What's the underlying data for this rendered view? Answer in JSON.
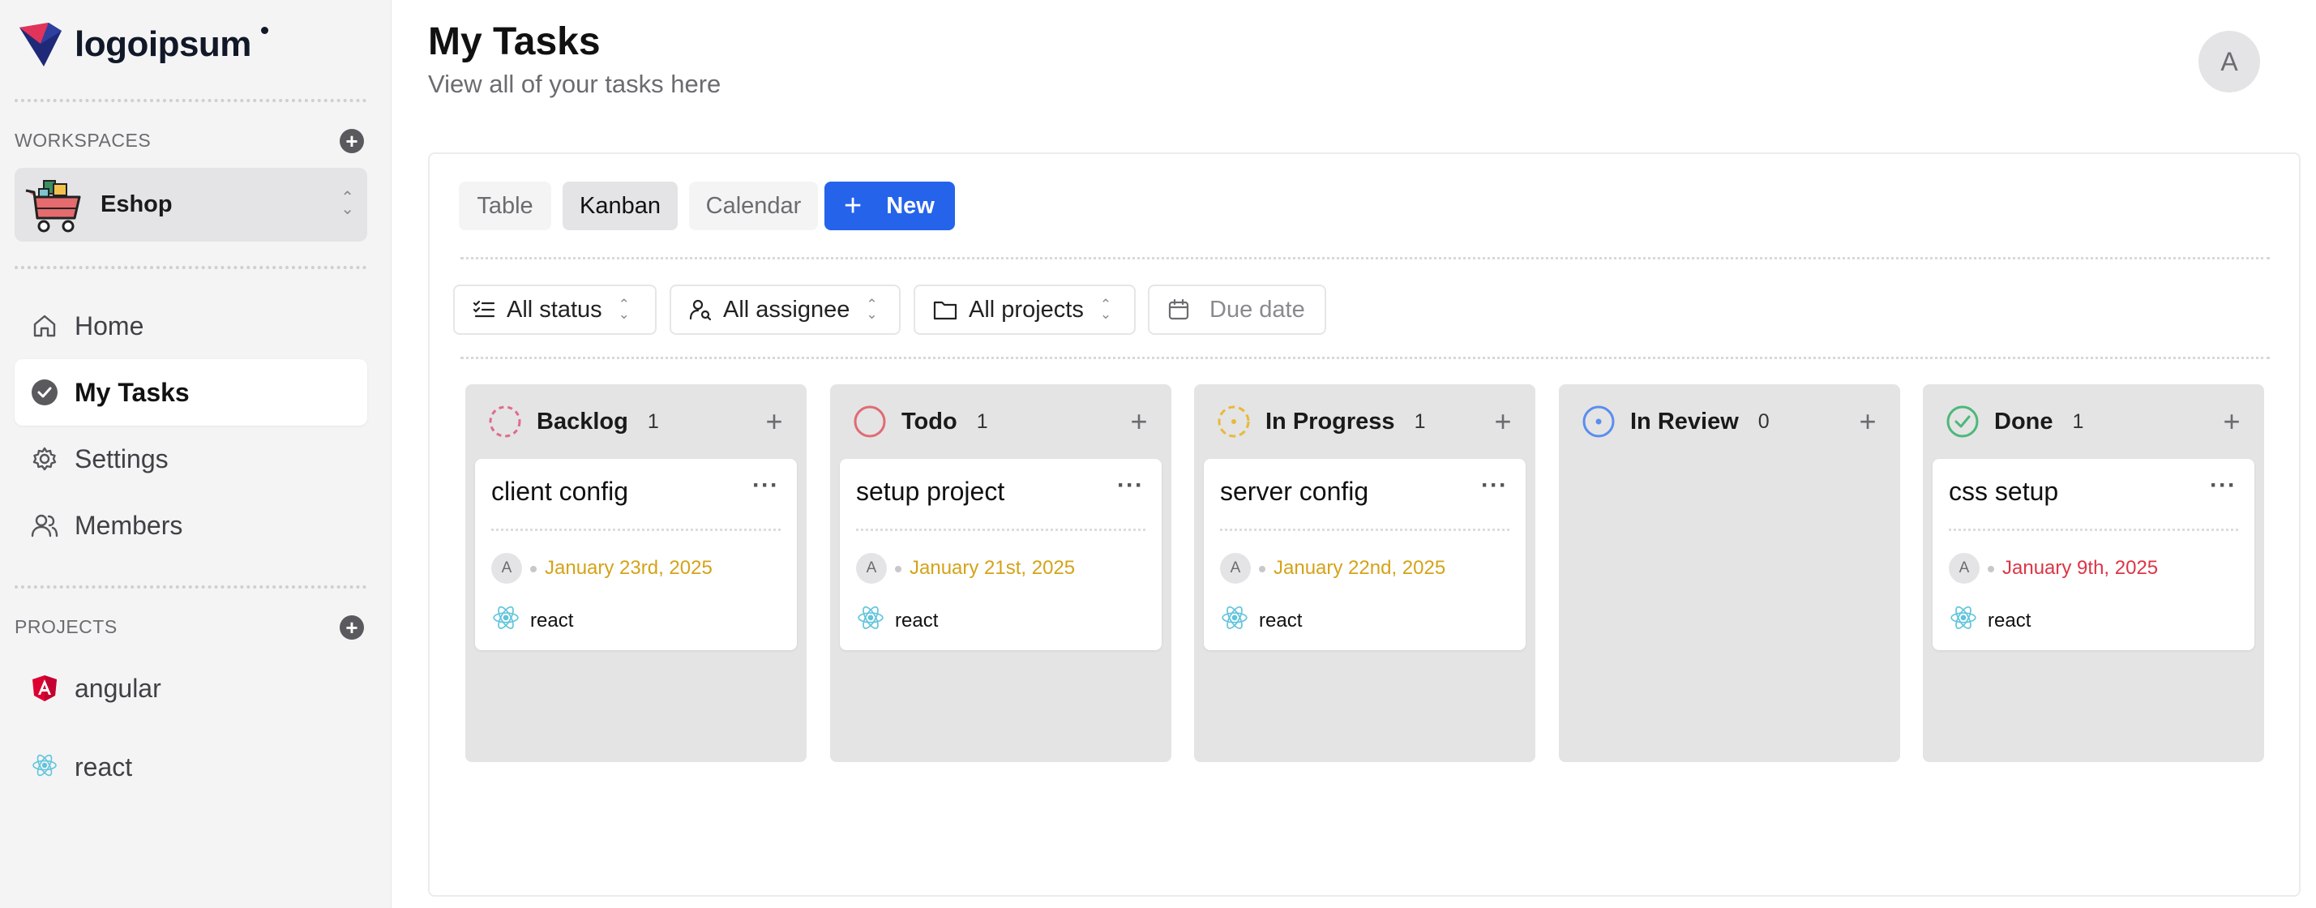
{
  "logo": {
    "text": "logoipsum"
  },
  "sidebar": {
    "workspaces_label": "WORKSPACES",
    "workspace": {
      "name": "Eshop"
    },
    "nav": [
      {
        "label": "Home",
        "icon": "home-icon"
      },
      {
        "label": "My Tasks",
        "icon": "check-circle-icon",
        "active": true
      },
      {
        "label": "Settings",
        "icon": "gear-icon"
      },
      {
        "label": "Members",
        "icon": "users-icon"
      }
    ],
    "projects_label": "PROJECTS",
    "projects": [
      {
        "label": "angular",
        "icon": "angular-icon"
      },
      {
        "label": "react",
        "icon": "react-icon"
      }
    ]
  },
  "header": {
    "title": "My Tasks",
    "subtitle": "View all of your tasks here",
    "avatar": "A"
  },
  "views": {
    "tabs": [
      {
        "label": "Table"
      },
      {
        "label": "Kanban",
        "active": true
      },
      {
        "label": "Calendar"
      }
    ],
    "new_label": "New"
  },
  "filters": {
    "status": "All status",
    "assignee": "All assignee",
    "projects": "All projects",
    "due_date": "Due date"
  },
  "colors": {
    "accent": "#2563eb",
    "backlog": "#e06b8b",
    "todo": "#e06b75",
    "in_progress": "#e8b93a",
    "in_review": "#5b8def",
    "done": "#4cb87a",
    "date_upcoming": "#d4a317",
    "date_overdue": "#dc3545"
  },
  "columns": [
    {
      "title": "Backlog",
      "count": "1",
      "cards": [
        {
          "title": "client config",
          "assignee": "A",
          "date": "January 23rd, 2025",
          "project": "react"
        }
      ]
    },
    {
      "title": "Todo",
      "count": "1",
      "cards": [
        {
          "title": "setup project",
          "assignee": "A",
          "date": "January 21st, 2025",
          "project": "react"
        }
      ]
    },
    {
      "title": "In Progress",
      "count": "1",
      "cards": [
        {
          "title": "server config",
          "assignee": "A",
          "date": "January 22nd, 2025",
          "project": "react"
        }
      ]
    },
    {
      "title": "In Review",
      "count": "0",
      "cards": []
    },
    {
      "title": "Done",
      "count": "1",
      "cards": [
        {
          "title": "css setup",
          "assignee": "A",
          "date": "January 9th, 2025",
          "project": "react"
        }
      ]
    }
  ]
}
